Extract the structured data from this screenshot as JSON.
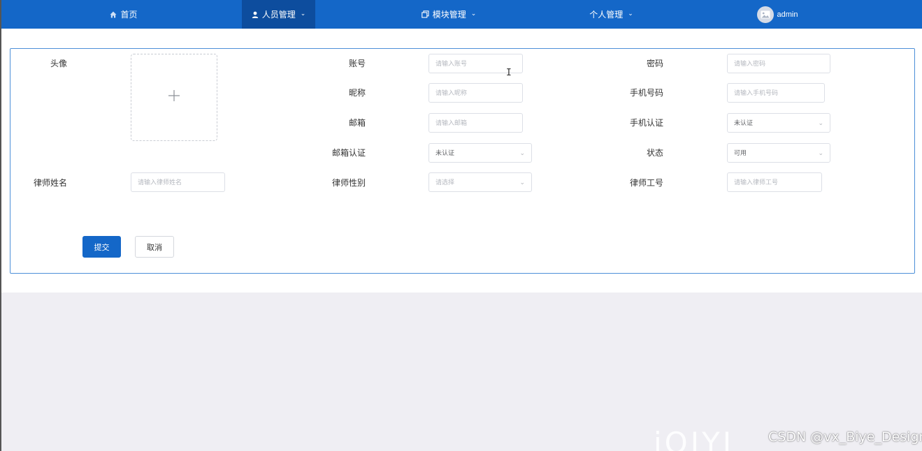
{
  "nav": {
    "home": "首页",
    "personnel": "人员管理",
    "modules": "模块管理",
    "personal": "个人管理",
    "user": "admin"
  },
  "form": {
    "avatar_label": "头像",
    "upload_symbol": "+",
    "account_label": "账号",
    "account_placeholder": "请输入账号",
    "password_label": "密码",
    "password_placeholder": "请输入密码",
    "nickname_label": "昵称",
    "nickname_placeholder": "请输入昵称",
    "phone_label": "手机号码",
    "phone_placeholder": "请输入手机号码",
    "email_label": "邮箱",
    "email_placeholder": "请输入邮箱",
    "phone_verify_label": "手机认证",
    "phone_verify_value": "未认证",
    "email_verify_label": "邮箱认证",
    "email_verify_value": "未认证",
    "status_label": "状态",
    "status_value": "可用",
    "lawyer_name_label": "律师姓名",
    "lawyer_name_placeholder": "请输入律师姓名",
    "lawyer_gender_label": "律师性别",
    "lawyer_gender_placeholder": "请选择",
    "lawyer_id_label": "律师工号",
    "lawyer_id_placeholder": "请输入律师工号",
    "submit": "提交",
    "cancel": "取消"
  },
  "watermark": "CSDN @vx_Biye_Design",
  "colors": {
    "primary": "#1467c8",
    "nav_active": "#0d4d9e",
    "page_bg": "#efeef3"
  }
}
